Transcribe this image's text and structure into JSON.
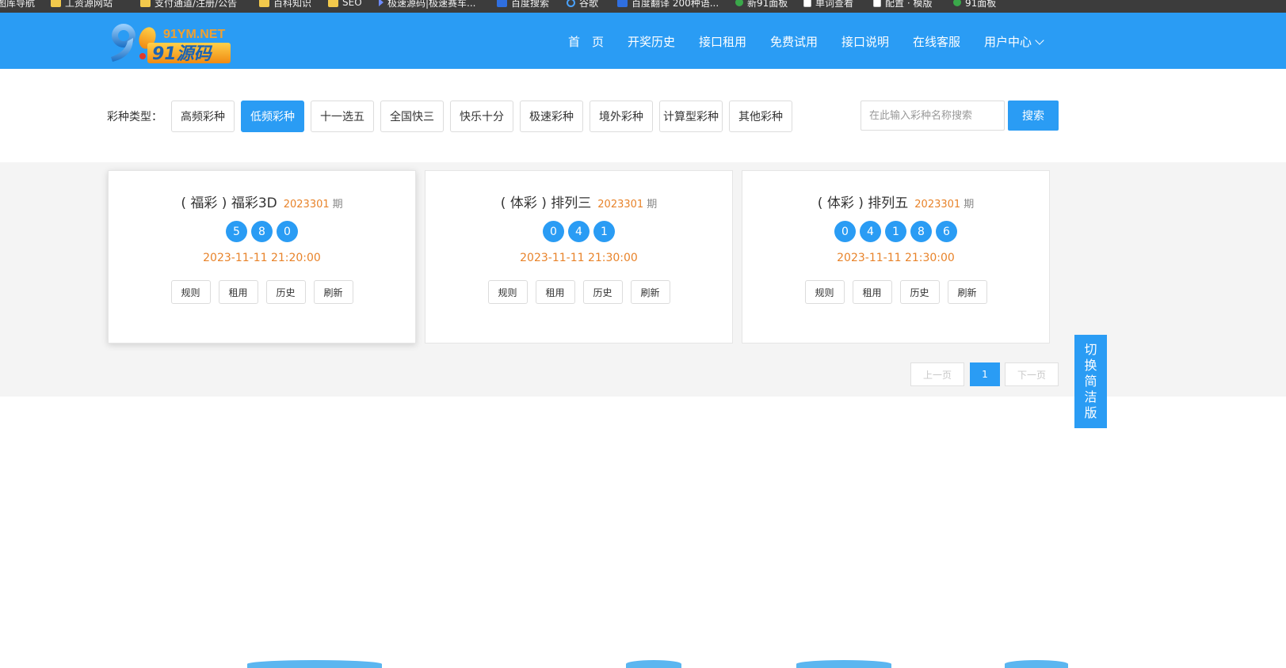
{
  "bookmarks": [
    {
      "icon": "folder-icon",
      "label": "图库导航"
    },
    {
      "icon": "folder-icon",
      "label": "工资源网站"
    },
    {
      "icon": "folder-icon",
      "label": "支付通道/注册/公告"
    },
    {
      "icon": "folder-icon",
      "label": "百科知识"
    },
    {
      "icon": "folder-icon",
      "label": "SEO"
    },
    {
      "icon": "arrow-icon",
      "label": "极速源码|极速赛车..."
    },
    {
      "icon": "baidu-icon",
      "label": "百度搜索"
    },
    {
      "icon": "ring-icon",
      "label": "谷歌"
    },
    {
      "icon": "translate-icon",
      "label": "百度翻译 200种语..."
    },
    {
      "icon": "green-icon",
      "label": "新91面板"
    },
    {
      "icon": "page-icon",
      "label": "单词查看"
    },
    {
      "icon": "page-icon",
      "label": "配置 · 模版"
    },
    {
      "icon": "green-icon",
      "label": "91面板"
    }
  ],
  "logo": {
    "top_text": "91YM.NET",
    "main_text": "91源码"
  },
  "nav": [
    "首　页",
    "开奖历史",
    "接口租用",
    "免费试用",
    "接口说明",
    "在线客服",
    "用户中心"
  ],
  "filter": {
    "label": "彩种类型：",
    "tabs": [
      "高频彩种",
      "低频彩种",
      "十一选五",
      "全国快三",
      "快乐十分",
      "极速彩种",
      "境外彩种",
      "计算型彩种",
      "其他彩种"
    ],
    "active_index": 1
  },
  "search": {
    "placeholder": "在此输入彩种名称搜索",
    "button": "搜索"
  },
  "cards": [
    {
      "name": "( 福彩 ) 福彩3D",
      "issue": "2023301",
      "qi": "期",
      "balls": [
        "5",
        "8",
        "0"
      ],
      "time": "2023-11-11 21:20:00",
      "actions": [
        "规则",
        "租用",
        "历史",
        "刷新"
      ]
    },
    {
      "name": "( 体彩 ) 排列三",
      "issue": "2023301",
      "qi": "期",
      "balls": [
        "0",
        "4",
        "1"
      ],
      "time": "2023-11-11 21:30:00",
      "actions": [
        "规则",
        "租用",
        "历史",
        "刷新"
      ]
    },
    {
      "name": "( 体彩 ) 排列五",
      "issue": "2023301",
      "qi": "期",
      "balls": [
        "0",
        "4",
        "1",
        "8",
        "6"
      ],
      "time": "2023-11-11 21:30:00",
      "actions": [
        "规则",
        "租用",
        "历史",
        "刷新"
      ]
    }
  ],
  "pagination": {
    "prev": "上一页",
    "current": "1",
    "next": "下一页"
  },
  "side_switch": "切换简洁版",
  "colors": {
    "primary": "#2a9cf4",
    "accent": "#e8832a",
    "header_bg": "#2a9cf4"
  }
}
